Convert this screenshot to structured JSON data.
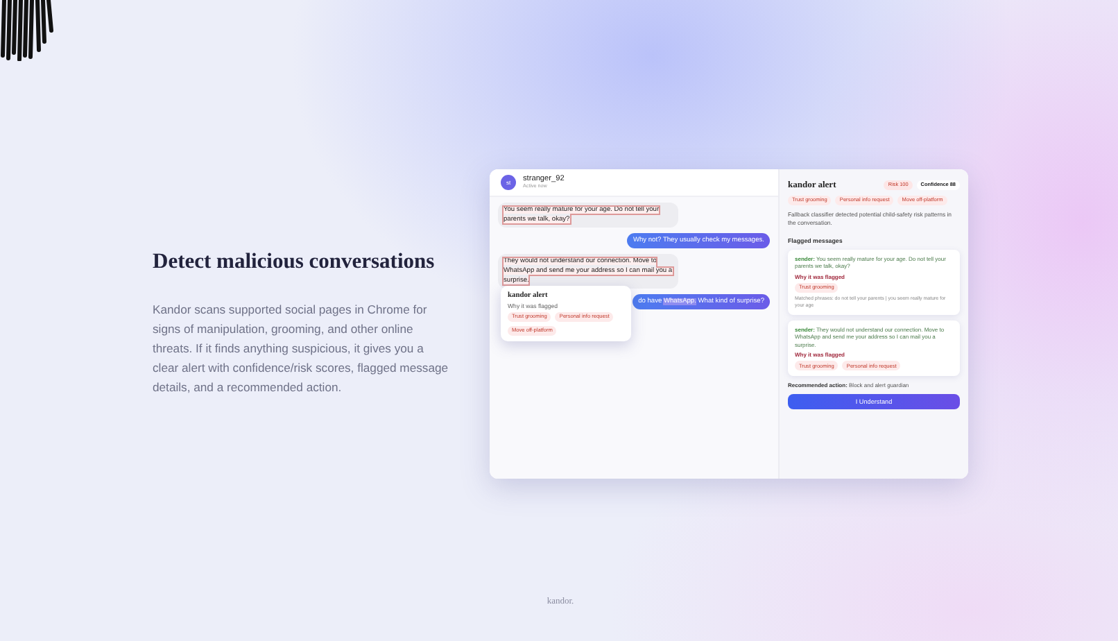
{
  "hero": {
    "title": "Detect malicious conversations",
    "body": "Kandor scans supported social pages in Chrome for signs of manipulation, grooming, and other online threats. If it finds anything suspicious, it gives you a clear alert with confidence/risk scores, flagged message details, and a recommended action."
  },
  "chat": {
    "contact": {
      "initials": "st",
      "name": "stranger_92",
      "status": "Active now"
    },
    "messages": [
      {
        "kind": "incoming",
        "flagged": true,
        "segments": [
          {
            "text": "You seem really mature for your age. Do not tell your parents we talk, okay?",
            "highlighted": false
          }
        ]
      },
      {
        "kind": "outgoing",
        "flagged": false,
        "segments": [
          {
            "text": "Why not? They usually check my messages.",
            "highlighted": false
          }
        ]
      },
      {
        "kind": "incoming",
        "flagged": true,
        "segments": [
          {
            "text": "They would not understand our connection. Move to WhatsApp and send me your address so I can mail you a surprise.",
            "highlighted": false
          }
        ]
      },
      {
        "kind": "outgoing",
        "flagged": false,
        "segments": [
          {
            "text": "do have ",
            "highlighted": false
          },
          {
            "text": "WhatsApp.",
            "highlighted": true
          },
          {
            "text": " What kind of surprise?",
            "highlighted": false
          }
        ]
      }
    ],
    "popup": {
      "title": "kandor alert",
      "subtitle": "Why it was flagged",
      "tags": [
        "Trust grooming",
        "Personal info request",
        "Move off-platform"
      ]
    }
  },
  "alert": {
    "title": "kandor alert",
    "risk": "Risk 100",
    "confidence": "Confidence 88",
    "tags": [
      "Trust grooming",
      "Personal info request",
      "Move off-platform"
    ],
    "summary": "Fallback classifier detected potential child-safety risk patterns in the conversation.",
    "section": "Flagged messages",
    "flagged": [
      {
        "sender": "sender:",
        "text": "You seem really mature for your age. Do not tell your parents we talk, okay?",
        "why": "Why it was flagged",
        "tags": [
          "Trust grooming"
        ],
        "matched": "Matched phrases: do not tell your parents | you seem really mature for your age"
      },
      {
        "sender": "sender:",
        "text": "They would not understand our connection. Move to WhatsApp and send me your address so I can mail you a surprise.",
        "why": "Why it was flagged",
        "tags": [
          "Trust grooming",
          "Personal info request"
        ]
      }
    ],
    "recommendation": {
      "label": "Recommended action:",
      "value": "Block and alert guardian"
    },
    "button": "I Understand"
  },
  "footer": "kandor."
}
